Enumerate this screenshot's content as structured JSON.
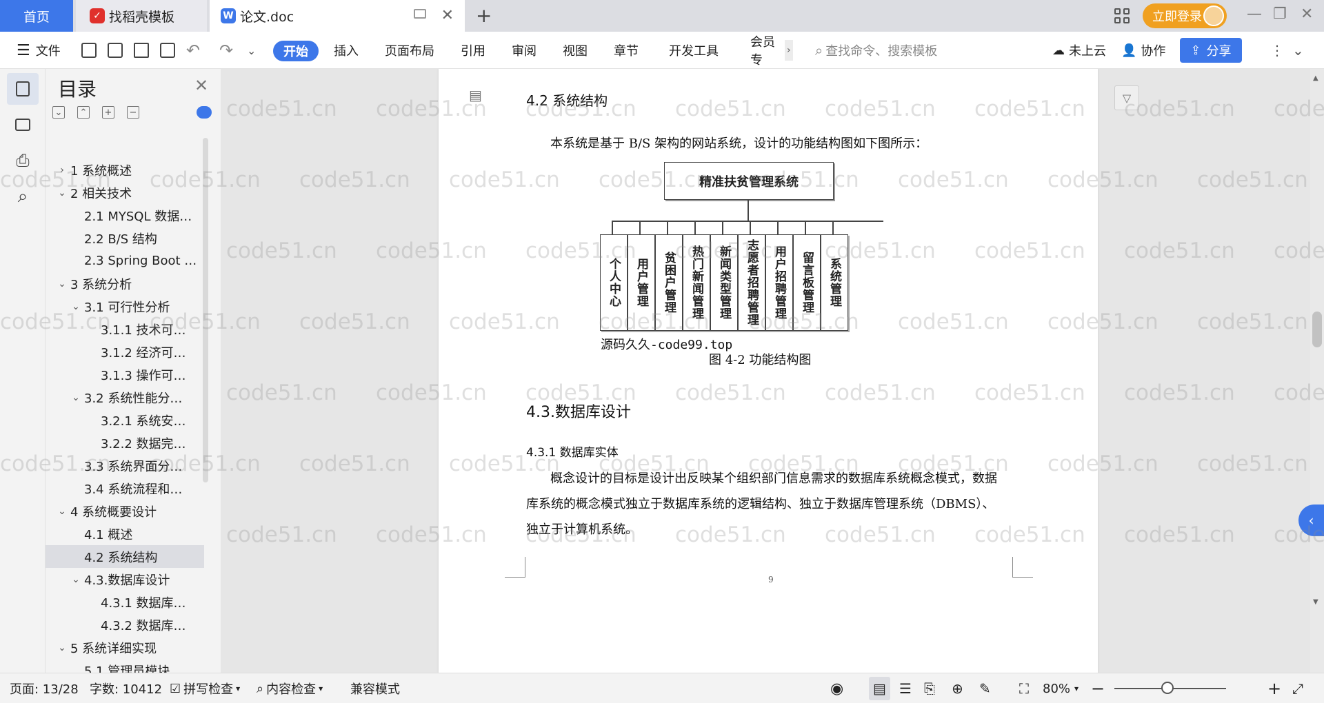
{
  "tabs": {
    "home": "首页",
    "templates": "找稻壳模板",
    "document": "论文.doc",
    "login": "立即登录"
  },
  "ribbon": {
    "file": "文件",
    "tabs": [
      "开始",
      "插入",
      "页面布局",
      "引用",
      "审阅",
      "视图",
      "章节",
      "开发工具",
      "会员专"
    ],
    "search_placeholder": "查找命令、搜索模板",
    "cloud": "未上云",
    "collab": "协作",
    "share": "分享"
  },
  "toc": {
    "title": "目录",
    "items": [
      {
        "label": "1 系统概述",
        "chev": "›",
        "level": 1
      },
      {
        "label": "2 相关技术",
        "chev": "⌄",
        "level": 1
      },
      {
        "label": "2.1 MYSQL 数据…",
        "chev": "",
        "level": 2
      },
      {
        "label": "2.2 B/S 结构",
        "chev": "",
        "level": 2
      },
      {
        "label": "2.3 Spring Boot …",
        "chev": "",
        "level": 2
      },
      {
        "label": "3 系统分析",
        "chev": "⌄",
        "level": 1
      },
      {
        "label": "3.1 可行性分析",
        "chev": "⌄",
        "level": 2
      },
      {
        "label": "3.1.1 技术可…",
        "chev": "",
        "level": 3
      },
      {
        "label": "3.1.2 经济可…",
        "chev": "",
        "level": 3
      },
      {
        "label": "3.1.3 操作可…",
        "chev": "",
        "level": 3
      },
      {
        "label": "3.2 系统性能分…",
        "chev": "⌄",
        "level": 2
      },
      {
        "label": "3.2.1  系统安…",
        "chev": "",
        "level": 3
      },
      {
        "label": "3.2.2  数据完…",
        "chev": "",
        "level": 3
      },
      {
        "label": "3.3 系统界面分…",
        "chev": "",
        "level": 2
      },
      {
        "label": "3.4 系统流程和…",
        "chev": "",
        "level": 2
      },
      {
        "label": "4 系统概要设计",
        "chev": "⌄",
        "level": 1
      },
      {
        "label": "4.1 概述",
        "chev": "",
        "level": 2
      },
      {
        "label": "4.2 系统结构",
        "chev": "",
        "level": 2,
        "selected": true
      },
      {
        "label": "4.3.数据库设计",
        "chev": "⌄",
        "level": 2
      },
      {
        "label": "4.3.1 数据库…",
        "chev": "",
        "level": 3
      },
      {
        "label": "4.3.2 数据库…",
        "chev": "",
        "level": 3
      },
      {
        "label": "5 系统详细实现",
        "chev": "⌄",
        "level": 1
      },
      {
        "label": "5.1 管理员模块…",
        "chev": "",
        "level": 2
      }
    ]
  },
  "document": {
    "heading_42": "4.2 系统结构",
    "intro": "本系统是基于 B/S 架构的网站系统，设计的功能结构图如下图所示：",
    "diagram": {
      "root": "精准扶贫管理系统",
      "children": [
        "个人中心",
        "用户管理",
        "贫困户管理",
        "热门新闻管理",
        "新闻类型管理",
        "志愿者招聘管理",
        "用户招聘管理",
        "留言板管理",
        "系统管理"
      ]
    },
    "source_note": "源码久久-code99.top",
    "caption": "图 4-2 功能结构图",
    "heading_43": "4.3.数据库设计",
    "heading_431": "4.3.1 数据库实体",
    "para_lines": [
      "概念设计的目标是设计出反映某个组织部门信息需求的数据库系统概念模式，数据",
      "库系统的概念模式独立于数据库系统的逻辑结构、独立于数据库管理系统（DBMS）、",
      "独立于计算机系统。"
    ],
    "page_number": "9"
  },
  "status": {
    "page": "页面: 13/28",
    "words": "字数: 10412",
    "spell": "拼写检查",
    "content": "内容检查",
    "compat": "兼容模式",
    "zoom": "80%"
  },
  "watermark_text": "code51.cn",
  "colors": {
    "accent": "#3d77e9",
    "login": "#f0a020"
  }
}
